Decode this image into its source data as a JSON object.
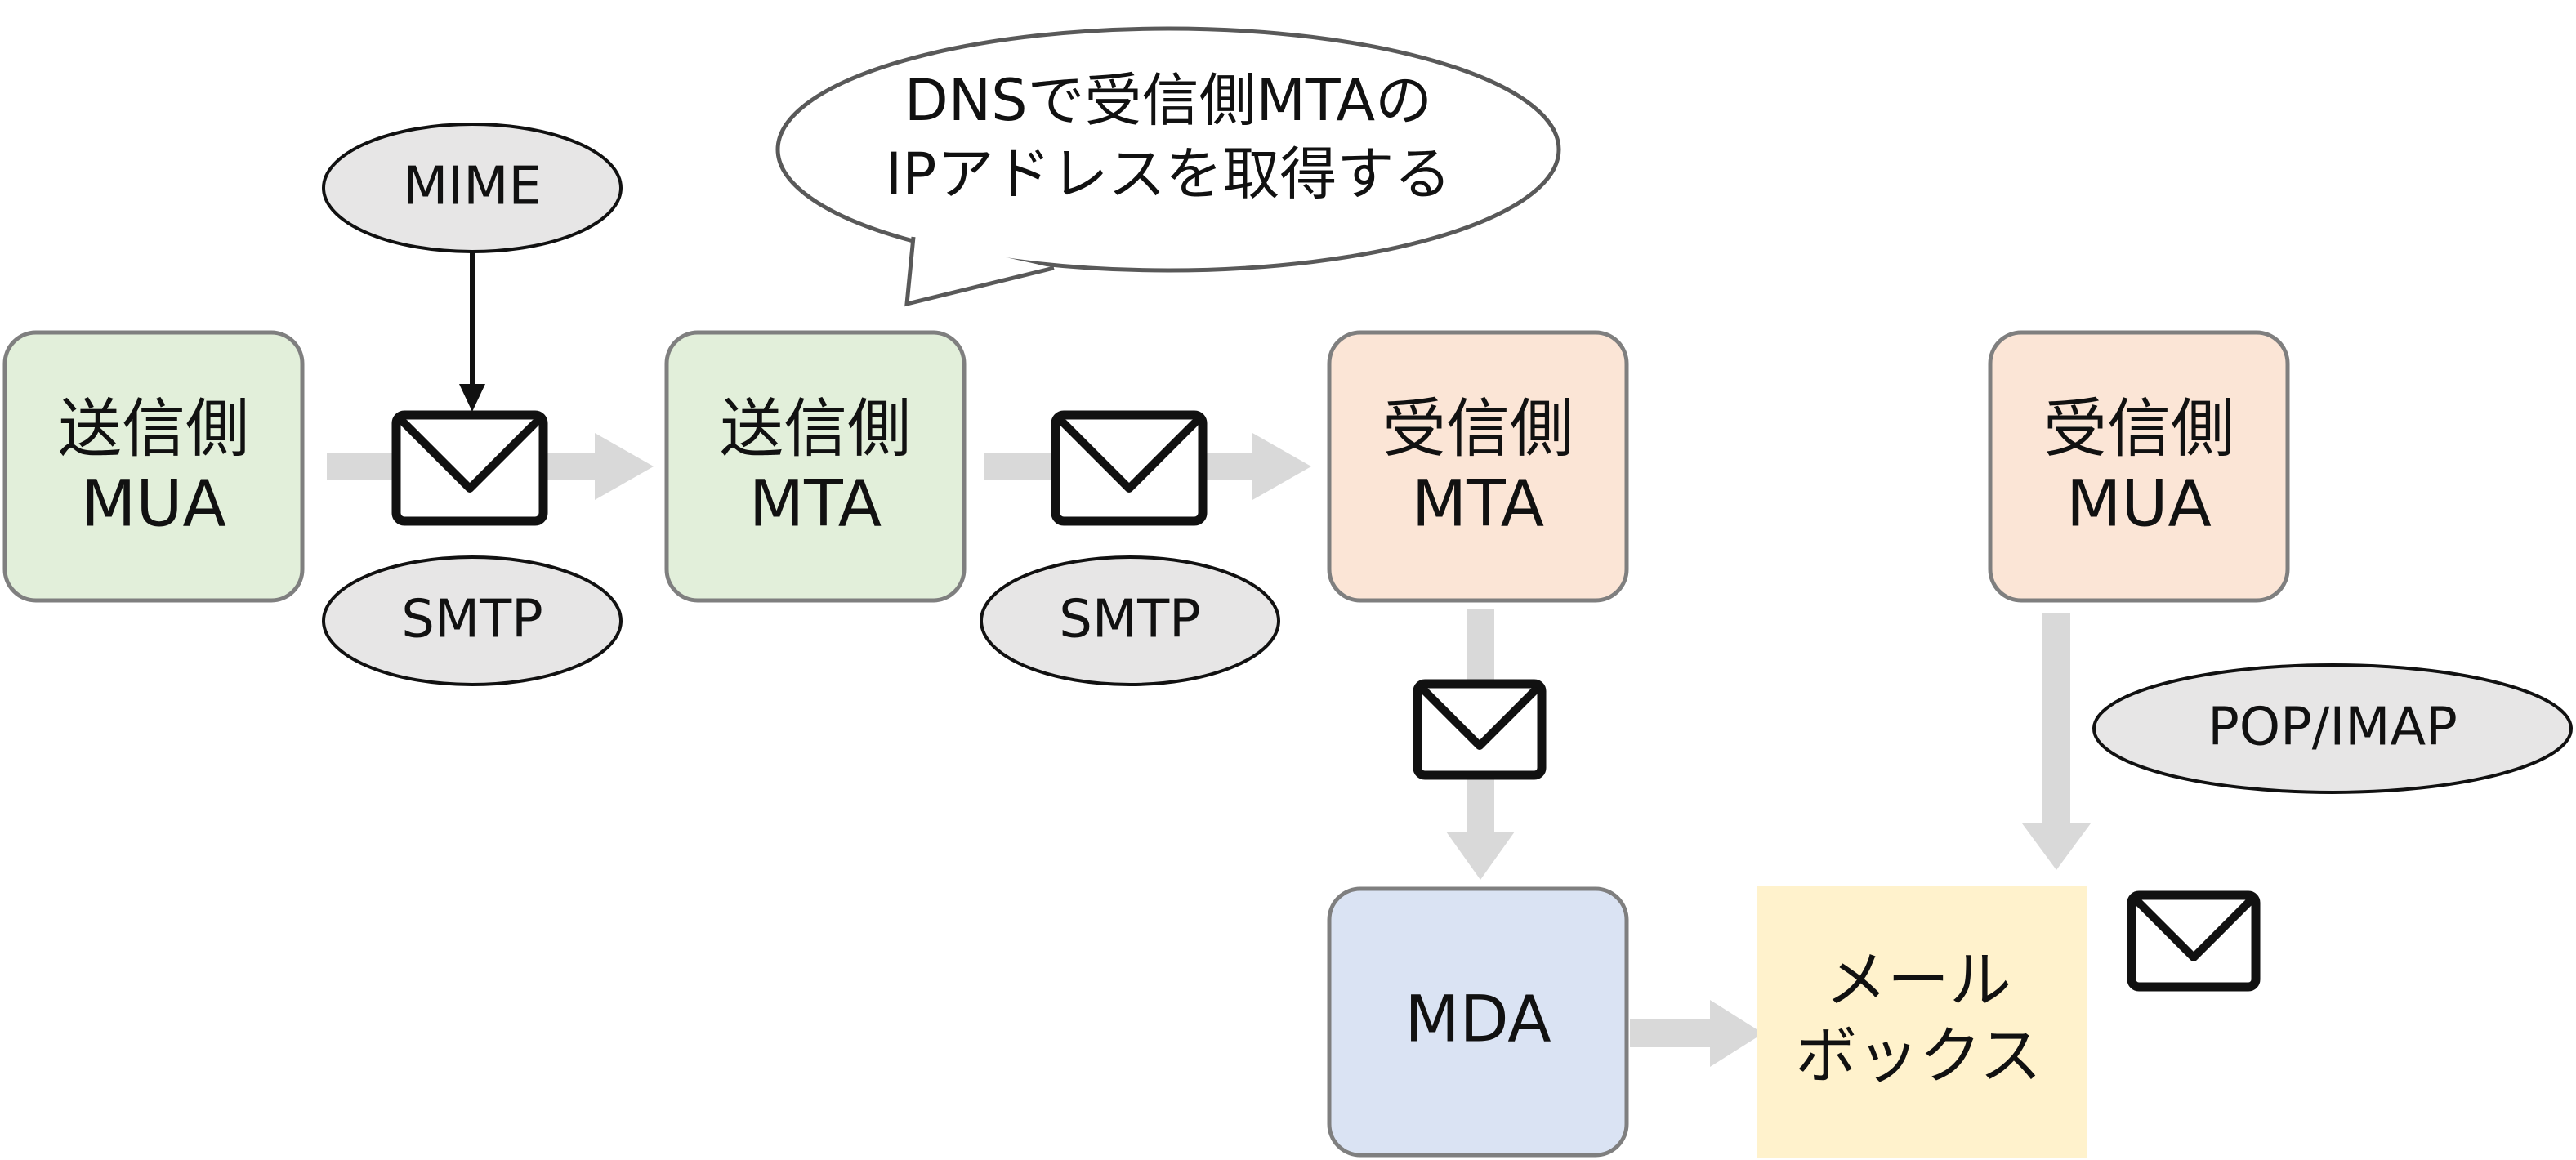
{
  "nodes": {
    "sender_mua": {
      "line1": "送信側",
      "line2": "MUA",
      "fill": "#e2efda"
    },
    "sender_mta": {
      "line1": "送信側",
      "line2": "MTA",
      "fill": "#e2efda"
    },
    "receiver_mta": {
      "line1": "受信側",
      "line2": "MTA",
      "fill": "#fbe5d6"
    },
    "receiver_mua": {
      "line1": "受信側",
      "line2": "MUA",
      "fill": "#fbe5d6"
    },
    "mda": {
      "label": "MDA",
      "fill": "#dae3f3"
    },
    "mailbox": {
      "line1": "メール",
      "line2": "ボックス",
      "fill": "#fff2cc"
    }
  },
  "protocols": {
    "mime": "MIME",
    "smtp_1": "SMTP",
    "smtp_2": "SMTP",
    "pop_imap": "POP/IMAP"
  },
  "callout": {
    "line1": "DNSで受信側MTAの",
    "line2": "IPアドレスを取得する"
  },
  "icons": {
    "envelope": "envelope-icon",
    "flow_arrow": "arrow-right-icon"
  },
  "colors": {
    "box_border": "#7f7f7f",
    "oval_fill": "#e7e6e6",
    "flow_arrow": "#d9d9d9",
    "text": "#111111"
  }
}
